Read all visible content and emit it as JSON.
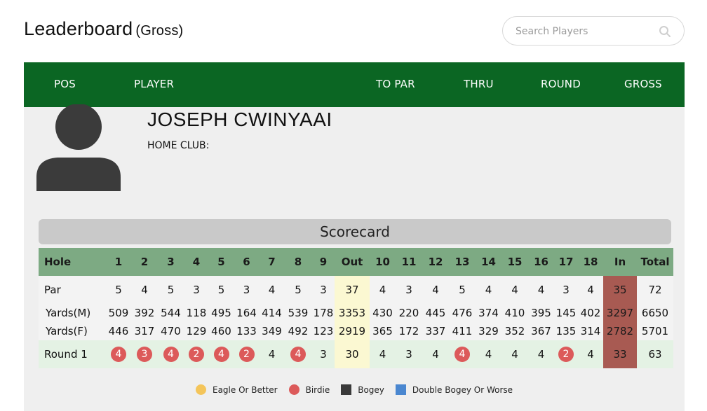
{
  "header": {
    "title": "Leaderboard",
    "subtitle": "(Gross)",
    "search_placeholder": "Search Players"
  },
  "leaderboard_columns": [
    "POS",
    "PLAYER",
    "TO PAR",
    "THRU",
    "ROUND",
    "GROSS"
  ],
  "player": {
    "name": "JOSEPH CWINYAAI",
    "home_club": "HOME CLUB:"
  },
  "scorecard": {
    "title": "Scorecard",
    "header": [
      "Hole",
      "1",
      "2",
      "3",
      "4",
      "5",
      "6",
      "7",
      "8",
      "9",
      "Out",
      "10",
      "11",
      "12",
      "13",
      "14",
      "15",
      "16",
      "17",
      "18",
      "In",
      "Total"
    ],
    "par": [
      "Par",
      "5",
      "4",
      "5",
      "3",
      "5",
      "3",
      "4",
      "5",
      "3",
      "37",
      "4",
      "3",
      "4",
      "5",
      "4",
      "4",
      "4",
      "3",
      "4",
      "35",
      "72"
    ],
    "yards_m": [
      "Yards(M)",
      "509",
      "392",
      "544",
      "118",
      "495",
      "164",
      "414",
      "539",
      "178",
      "3353",
      "430",
      "220",
      "445",
      "476",
      "374",
      "410",
      "395",
      "145",
      "402",
      "3297",
      "6650"
    ],
    "yards_f": [
      "Yards(F)",
      "446",
      "317",
      "470",
      "129",
      "460",
      "133",
      "349",
      "492",
      "123",
      "2919",
      "365",
      "172",
      "337",
      "411",
      "329",
      "352",
      "367",
      "135",
      "314",
      "2782",
      "5701"
    ],
    "round1": [
      "Round 1",
      "4",
      "3",
      "4",
      "2",
      "4",
      "2",
      "4",
      "4",
      "3",
      "30",
      "4",
      "3",
      "4",
      "4",
      "4",
      "4",
      "4",
      "2",
      "4",
      "33",
      "63"
    ],
    "round1_marks": [
      "",
      "birdie",
      "birdie",
      "birdie",
      "birdie",
      "birdie",
      "birdie",
      "",
      "birdie",
      "",
      "",
      "",
      "",
      "",
      "birdie",
      "",
      "",
      "",
      "birdie",
      "",
      "",
      ""
    ]
  },
  "legend": [
    {
      "label": "Eagle Or Better",
      "color": "#f4c55a",
      "shape": "circle"
    },
    {
      "label": "Birdie",
      "color": "#dc5a5a",
      "shape": "circle"
    },
    {
      "label": "Bogey",
      "color": "#3a3a3a",
      "shape": "square"
    },
    {
      "label": "Double Bogey Or Worse",
      "color": "#4a87d0",
      "shape": "square"
    }
  ],
  "colors": {
    "header_green": "#0b6623",
    "table_header_green": "#7daa83",
    "out_highlight": "#fbf8d2",
    "in_highlight": "#a85a52",
    "round_row": "#e4f2e4"
  }
}
